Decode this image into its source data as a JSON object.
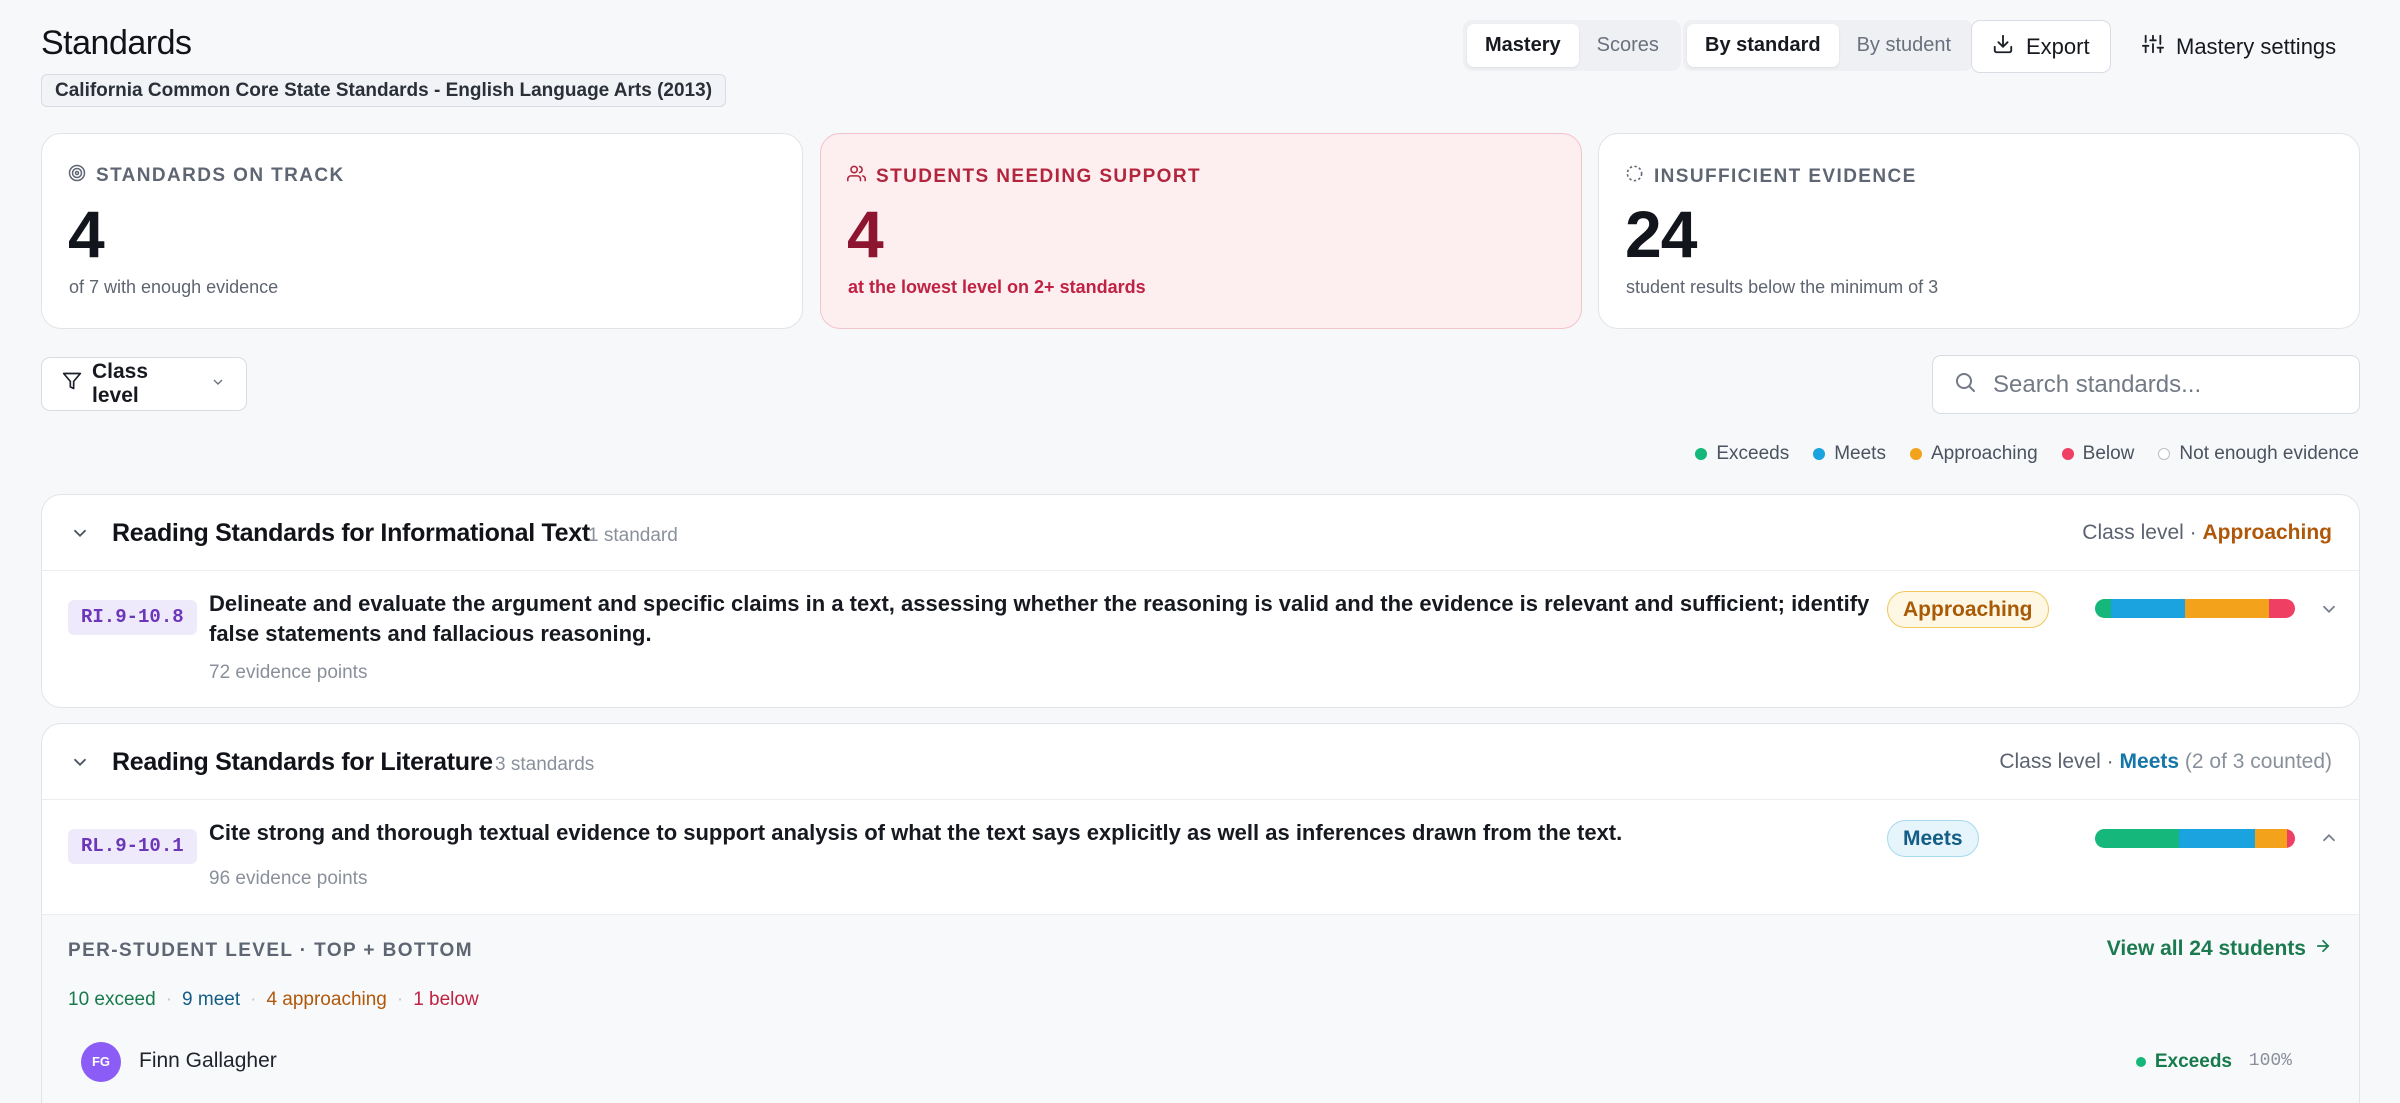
{
  "header": {
    "title": "Standards",
    "framework": "California Common Core State Standards - English Language Arts (2013)",
    "view_toggle": {
      "mastery": "Mastery",
      "scores": "Scores",
      "active": "Mastery"
    },
    "group_toggle": {
      "by_standard": "By standard",
      "by_student": "By student",
      "active": "By standard"
    },
    "export_label": "Export",
    "settings_label": "Mastery settings"
  },
  "stats": [
    {
      "label": "STANDARDS ON TRACK",
      "value": "4",
      "sub": "of 7 with enough evidence",
      "icon": "target-icon"
    },
    {
      "label": "STUDENTS NEEDING SUPPORT",
      "value": "4",
      "sub": "at the lowest level on 2+ standards",
      "icon": "users-icon"
    },
    {
      "label": "INSUFFICIENT EVIDENCE",
      "value": "24",
      "sub": "student results below the minimum of 3",
      "icon": "loader-icon"
    }
  ],
  "filter": {
    "label": "Class level"
  },
  "search": {
    "placeholder": "Search standards..."
  },
  "legend": [
    {
      "label": "Exceeds",
      "color": "#16b77a"
    },
    {
      "label": "Meets",
      "color": "#1aa3de"
    },
    {
      "label": "Approaching",
      "color": "#f2a21b"
    },
    {
      "label": "Below",
      "color": "#ef3f63"
    },
    {
      "label": "Not enough evidence",
      "color": "#ffffff"
    }
  ],
  "groups": [
    {
      "title": "Reading Standards for Informational Text",
      "count": "1 standard",
      "level_prefix": "Class level ·",
      "level": "Approaching",
      "level_suffix": "",
      "standards": [
        {
          "code": "RI.9-10.8",
          "text": "Delineate and evaluate the argument and specific claims in a text, assessing whether the reasoning is valid and the evidence is relevant and sufficient; identify false statements and fallacious reasoning.",
          "evidence": "72 evidence points",
          "level": "Approaching",
          "distribution": {
            "exceeds": 0.08,
            "meets": 0.37,
            "approaching": 0.42,
            "below": 0.13
          }
        }
      ]
    },
    {
      "title": "Reading Standards for Literature",
      "count": "3 standards",
      "level_prefix": "Class level ·",
      "level": "Meets",
      "level_suffix": "(2 of 3 counted)",
      "standards": [
        {
          "code": "RL.9-10.1",
          "text": "Cite strong and thorough textual evidence to support analysis of what the text says explicitly as well as inferences drawn from the text.",
          "evidence": "96 evidence points",
          "level": "Meets",
          "distribution": {
            "exceeds": 0.42,
            "meets": 0.38,
            "approaching": 0.16,
            "below": 0.04
          }
        }
      ],
      "expanded": {
        "title": "PER-STUDENT LEVEL · TOP + BOTTOM",
        "view_all": "View all 24 students",
        "counts": {
          "exceed": "10 exceed",
          "meet": "9 meet",
          "approaching": "4 approaching",
          "below": "1 below"
        },
        "students": [
          {
            "initials": "FG",
            "name": "Finn Gallagher",
            "level": "Exceeds",
            "pct": "100%"
          }
        ]
      }
    }
  ]
}
